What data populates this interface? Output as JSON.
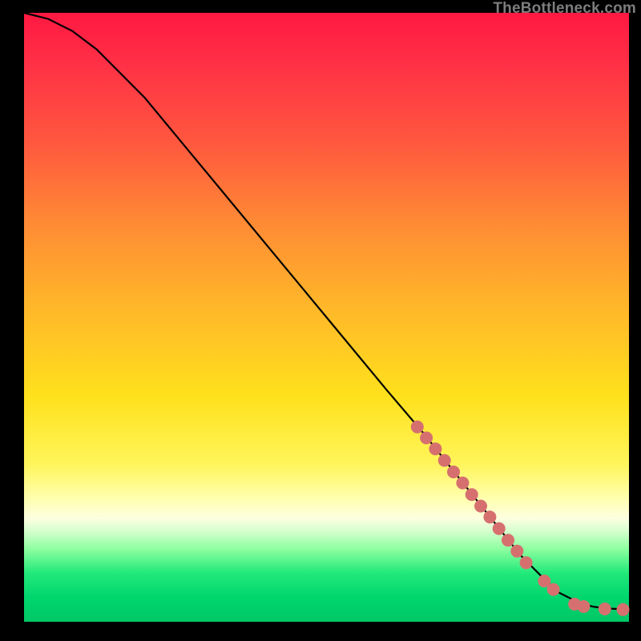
{
  "attribution": "TheBottleneck.com",
  "chart_data": {
    "type": "line",
    "title": "",
    "xlabel": "",
    "ylabel": "",
    "xlim": [
      0,
      100
    ],
    "ylim": [
      0,
      100
    ],
    "series": [
      {
        "name": "curve",
        "x": [
          0,
          4,
          8,
          12,
          20,
          30,
          40,
          50,
          60,
          66,
          70,
          74,
          78,
          82,
          86,
          88,
          90,
          92,
          94,
          96,
          98,
          100
        ],
        "y": [
          100,
          99,
          97,
          94,
          86,
          74,
          62,
          50,
          38,
          31,
          26,
          21,
          16,
          11,
          7,
          5,
          4,
          3,
          2.5,
          2.2,
          2.1,
          2.0
        ]
      }
    ],
    "markers": [
      {
        "x": 65.0,
        "y": 32.0
      },
      {
        "x": 66.5,
        "y": 30.2
      },
      {
        "x": 68.0,
        "y": 28.4
      },
      {
        "x": 69.5,
        "y": 26.5
      },
      {
        "x": 71.0,
        "y": 24.6
      },
      {
        "x": 72.5,
        "y": 22.8
      },
      {
        "x": 74.0,
        "y": 20.9
      },
      {
        "x": 75.5,
        "y": 19.0
      },
      {
        "x": 77.0,
        "y": 17.2
      },
      {
        "x": 78.5,
        "y": 15.3
      },
      {
        "x": 80.0,
        "y": 13.4
      },
      {
        "x": 81.5,
        "y": 11.6
      },
      {
        "x": 83.0,
        "y": 9.7
      },
      {
        "x": 86.0,
        "y": 6.7
      },
      {
        "x": 87.5,
        "y": 5.3
      },
      {
        "x": 91.0,
        "y": 2.9
      },
      {
        "x": 92.5,
        "y": 2.5
      },
      {
        "x": 96.0,
        "y": 2.1
      },
      {
        "x": 99.0,
        "y": 2.0
      }
    ],
    "marker_radius_px": 8,
    "gradient_stops": [
      {
        "pos": 0.0,
        "color": "#ff1842"
      },
      {
        "pos": 0.35,
        "color": "#ff8c34"
      },
      {
        "pos": 0.63,
        "color": "#ffe11c"
      },
      {
        "pos": 0.83,
        "color": "#fdffe0"
      },
      {
        "pos": 0.92,
        "color": "#22e97a"
      },
      {
        "pos": 1.0,
        "color": "#00c766"
      }
    ]
  }
}
